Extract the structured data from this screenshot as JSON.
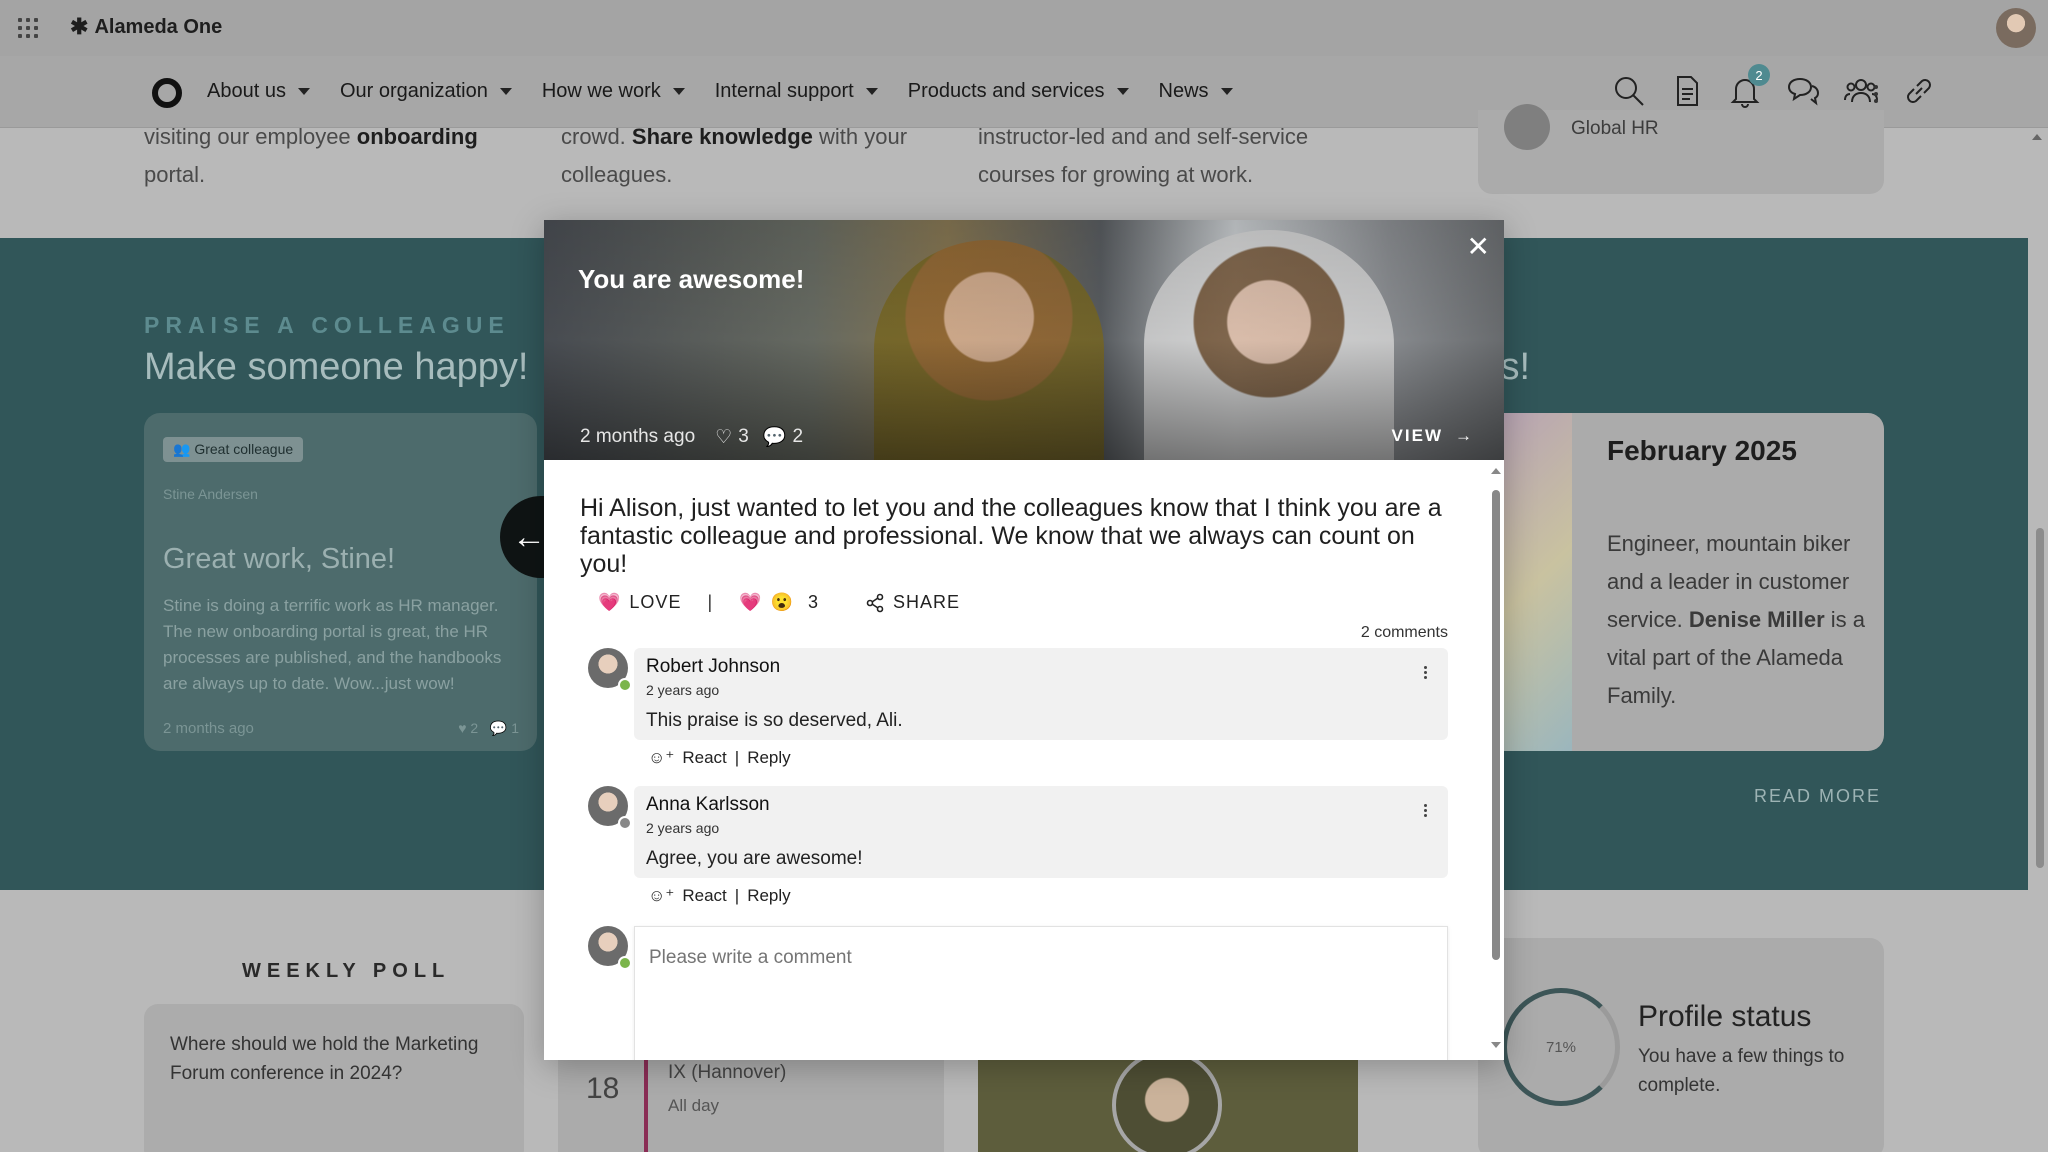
{
  "app": {
    "title": "Alameda One"
  },
  "nav": {
    "items": [
      {
        "label": "About us"
      },
      {
        "label": "Our organization"
      },
      {
        "label": "How we work"
      },
      {
        "label": "Internal support"
      },
      {
        "label": "Products and services"
      },
      {
        "label": "News"
      }
    ],
    "notifications_count": "2"
  },
  "background": {
    "col1_line1_pre": "visiting our employee ",
    "col1_line1_bold": "onboarding",
    "col1_line2": "portal.",
    "col2_line1_pre": "crowd. ",
    "col2_line1_bold": "Share knowledge",
    "col2_line1_post": " with your",
    "col2_line2": "colleagues.",
    "col3_line1": "instructor-led and and self-service",
    "col3_line2": "courses for growing at work.",
    "hr_card_label": "Global HR",
    "praise_kicker": "PRAISE A COLLEAGUE",
    "praise_title": "Make someone happy!",
    "ts_title_fragment": "ts!",
    "praise_card": {
      "chip": "Great colleague",
      "name": "Stine Andersen",
      "title": "Great work, Stine!",
      "body": "Stine is doing a terrific work as HR manager. The new onboarding portal is great, the HR processes are published, and the handbooks are always up to date. Wow...just wow!",
      "time": "2 months ago",
      "likes": "2",
      "comments": "1"
    },
    "feb_card": {
      "title": "February 2025",
      "body_pre": "Engineer, mountain biker and a leader in customer service. ",
      "body_bold": "Denise Miller",
      "body_post": " is a vital part of the Alameda Family."
    },
    "read_more": "READ MORE",
    "poll_kicker": "WEEKLY POLL",
    "poll_question": "Where should we hold the Marketing Forum conference in 2024?",
    "calendar": {
      "day": "18",
      "title": "IX (Hannover)",
      "sub": "All day"
    },
    "profile": {
      "percent": "71%",
      "title": "Profile status",
      "sub": "You have a few things to complete."
    }
  },
  "modal": {
    "title": "You are awesome!",
    "time": "2 months ago",
    "likes": "3",
    "comments": "2",
    "view_label": "VIEW",
    "message": "Hi Alison, just wanted to let you and the colleagues know that I think you are a fantastic colleague and professional. We know that we always can count on you!",
    "love_label": "LOVE",
    "reactions_count": "3",
    "share_label": "SHARE",
    "comments_count": "2 comments",
    "comment_list": [
      {
        "name": "Robert Johnson",
        "time": "2 years ago",
        "text": "This praise is so deserved, Ali.",
        "react": "React",
        "reply": "Reply"
      },
      {
        "name": "Anna Karlsson",
        "time": "2 years ago",
        "text": "Agree, you are awesome!",
        "react": "React",
        "reply": "Reply"
      }
    ],
    "composer_placeholder": "Please write a comment"
  }
}
